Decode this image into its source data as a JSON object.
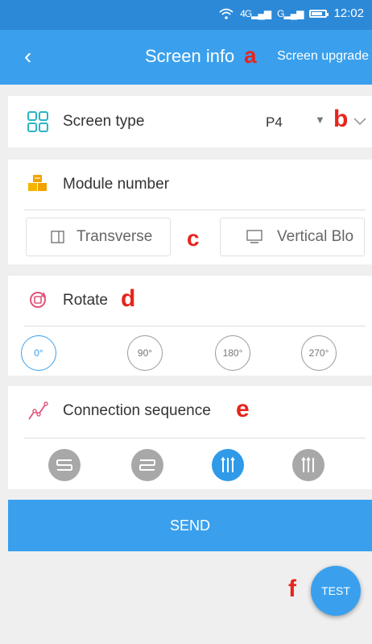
{
  "status": {
    "time": "12:02",
    "net1": "4G",
    "net2": "G"
  },
  "nav": {
    "title": "Screen info",
    "upgrade": "Screen upgrade"
  },
  "screen_type": {
    "label": "Screen type",
    "value": "P4"
  },
  "module": {
    "label": "Module number",
    "transverse": "Transverse",
    "vertical": "Vertical Blo"
  },
  "rotate": {
    "label": "Rotate",
    "options": [
      "0°",
      "90°",
      "180°",
      "270°"
    ],
    "selected": "0°"
  },
  "connection": {
    "label": "Connection sequence"
  },
  "send_label": "SEND",
  "test_label": "TEST",
  "annotations": {
    "a": "a",
    "b": "b",
    "c": "c",
    "d": "d",
    "e": "e",
    "f": "f"
  },
  "colors": {
    "accent": "#3aa0ed",
    "status_bar": "#2c89d8",
    "mark": "#e8241c"
  }
}
